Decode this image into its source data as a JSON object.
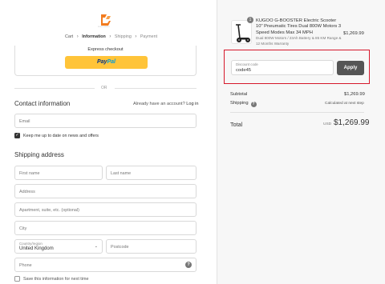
{
  "colors": {
    "accent": "#d6182b",
    "paypal_yellow": "#ffc439",
    "apply_button": "#555555",
    "logo": "#f27b1e"
  },
  "logo": {
    "icon": "kugoo-logo",
    "text": "KUGOO-MIRKO"
  },
  "breadcrumb": {
    "items": [
      "Cart",
      "Information",
      "Shipping",
      "Payment"
    ],
    "active": "Information"
  },
  "express": {
    "title": "Express checkout",
    "paypal_a": "Pay",
    "paypal_b": "Pal"
  },
  "divider_label": "OR",
  "contact": {
    "heading": "Contact information",
    "account_prompt": "Already have an account?",
    "login_label": "Log in",
    "email_placeholder": "Email",
    "newsletter_label": "Keep me up to date on news and offers",
    "newsletter_checked": true
  },
  "shipping": {
    "heading": "Shipping address",
    "first_name_placeholder": "First name",
    "last_name_placeholder": "Last name",
    "address_placeholder": "Address",
    "apartment_placeholder": "Apartment, suite, etc. (optional)",
    "city_placeholder": "City",
    "country_label": "Country/region",
    "country_value": "United Kingdom",
    "postcode_placeholder": "Postcode",
    "phone_placeholder": "Phone",
    "save_info_label": "Save this information for next time"
  },
  "order": {
    "quantity": "1",
    "product_title": "KUGOO G-BOOSTER Electric Scooter 10\" Pneumatic Tires Dual 800W Motors 3 Speed Modes Max 34 MPH",
    "product_variant": "Dual 800W Motors / 23Ah Battery & 85 KM Range & 12 Months Warranty",
    "product_price": "$1,269.99",
    "discount_label": "Discount code",
    "discount_value": "code45",
    "apply_label": "Apply",
    "subtotal_label": "Subtotal",
    "subtotal_value": "$1,269.99",
    "shipping_label": "Shipping",
    "shipping_value": "Calculated at next step",
    "total_label": "Total",
    "total_currency": "USD",
    "total_value": "$1,269.99"
  }
}
